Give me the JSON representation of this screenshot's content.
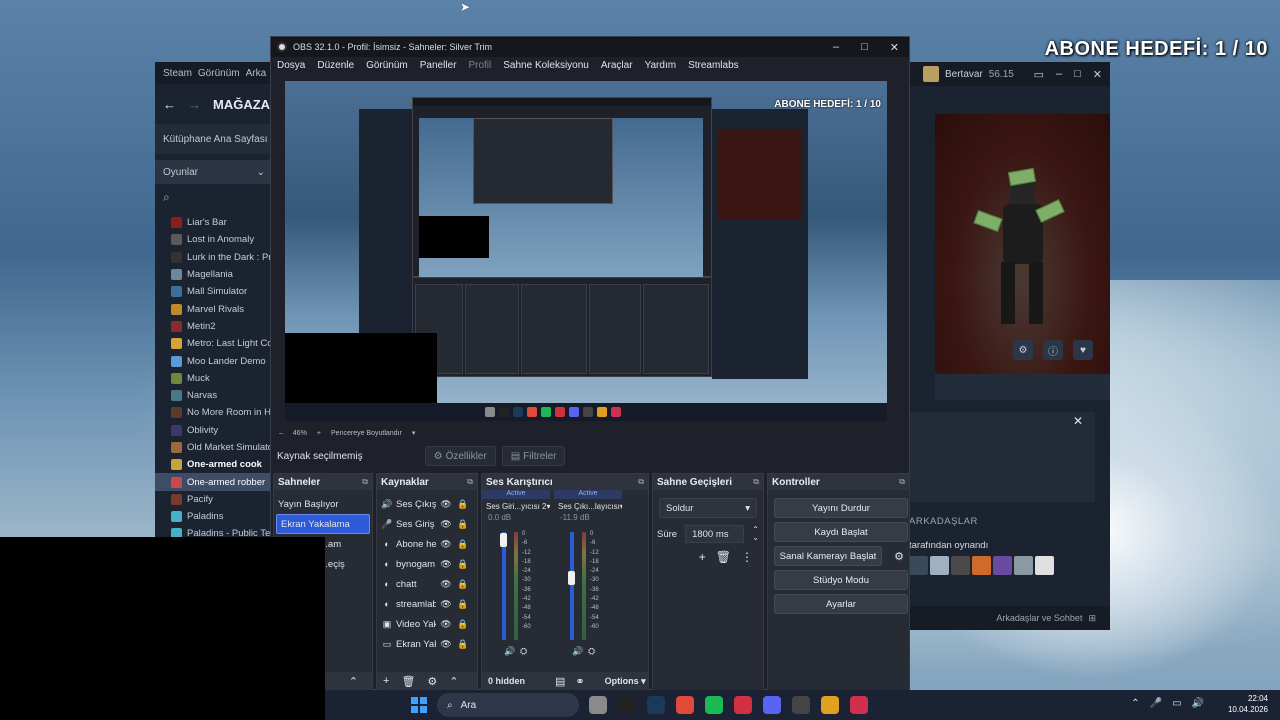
{
  "overlay": {
    "goal": "ABONE HEDEFİ: 1 / 10"
  },
  "steam": {
    "menu": [
      "Steam",
      "Görünüm",
      "Arka"
    ],
    "store": "MAĞAZA",
    "library_home": "Kütüphane Ana Sayfası",
    "filter": "Oyunlar",
    "games": [
      {
        "name": "Liar's Bar",
        "color": "#8a1d1d"
      },
      {
        "name": "Lost in Anomaly",
        "color": "#5a5a5a"
      },
      {
        "name": "Lurk in the Dark : Pr",
        "color": "#333333"
      },
      {
        "name": "Magellania",
        "color": "#6a8a9c"
      },
      {
        "name": "Mall Simulator",
        "color": "#3d6f9e"
      },
      {
        "name": "Marvel Rivals",
        "color": "#c08a2a"
      },
      {
        "name": "Metin2",
        "color": "#8a2a2a"
      },
      {
        "name": "Metro: Last Light Co",
        "color": "#d6a23a"
      },
      {
        "name": "Moo Lander Demo",
        "color": "#5a9ad6"
      },
      {
        "name": "Muck",
        "color": "#6c8a3a"
      },
      {
        "name": "Narvas",
        "color": "#4a7a8a"
      },
      {
        "name": "No More Room in He",
        "color": "#5a3a2a"
      },
      {
        "name": "Oblivity",
        "color": "#3a3a6a"
      },
      {
        "name": "Old Market Simulato",
        "color": "#9a6a3a"
      },
      {
        "name": "One-armed cook",
        "color": "#c9a23a"
      },
      {
        "name": "One-armed robber",
        "color": "#c94a4a"
      },
      {
        "name": "Pacify",
        "color": "#7a3a2a"
      },
      {
        "name": "Paladins",
        "color": "#4ab0c9"
      },
      {
        "name": "Paladins - Public Te",
        "color": "#4ab0c9"
      }
    ]
  },
  "steam_right": {
    "user": "Bertavar",
    "balance": "56.15",
    "friends_header": "ARKADAŞLAR",
    "played": "tarafından oynandı",
    "footer": "Arkadaşlar ve Sohbet",
    "avatar_colors": [
      "#3a4a5a",
      "#a0b0c0",
      "#4a4a4a",
      "#d06a2a",
      "#6a4aa0",
      "#8a9aa0",
      "#e0e0e0"
    ]
  },
  "obs": {
    "title": "OBS 32.1.0 - Profil: İsimsiz - Sahneler: Silver Trim",
    "menu": [
      "Dosya",
      "Düzenle",
      "Görünüm",
      "Paneller",
      "Profil",
      "Sahne Koleksiyonu",
      "Araçlar",
      "Yardım",
      "Streamlabs"
    ],
    "zoom": "46%",
    "fit": "Pencereye Boyutlandır",
    "no_source": "Kaynak seçilmemiş",
    "properties": "Özellikler",
    "filters": "Filtreler",
    "scenes": {
      "title": "Sahneler",
      "items": [
        "Yayın Başlıyor",
        "Ekran Yakalama",
        "...am",
        "...eçiş"
      ]
    },
    "sources": {
      "title": "Kaynaklar",
      "items": [
        {
          "icon": "🔊",
          "name": "Ses Çıkış Y"
        },
        {
          "icon": "🎤",
          "name": "Ses Giriş Y"
        },
        {
          "icon": "◐",
          "name": "Abone hed"
        },
        {
          "icon": "◐",
          "name": "bynogamı"
        },
        {
          "icon": "◐",
          "name": "chatt"
        },
        {
          "icon": "◐",
          "name": "streamlab"
        },
        {
          "icon": "▣",
          "name": "Video Yak"
        },
        {
          "icon": "▭",
          "name": "Ekran Yak"
        }
      ]
    },
    "mixer": {
      "title": "Ses Karıştırıcı",
      "channels": [
        {
          "active": "Active",
          "name": "Ses Giri...yıcısı 2",
          "db": "0.0 dB",
          "level": 0.95
        },
        {
          "active": "Active",
          "name": "Ses Çıkı...layıcısı",
          "db": "-11.9 dB",
          "level": 0.6
        }
      ],
      "scale": [
        "0",
        "-6",
        "-12",
        "-18",
        "-24",
        "-30",
        "-36",
        "-42",
        "-48",
        "-54",
        "-60"
      ],
      "hidden": "0 hidden",
      "options": "Options"
    },
    "transitions": {
      "title": "Sahne Geçişleri",
      "type": "Soldur",
      "duration_label": "Süre",
      "duration": "1800 ms"
    },
    "controls": {
      "title": "Kontroller",
      "stop_stream": "Yayını Durdur",
      "start_record": "Kaydı Başlat",
      "virtual_cam": "Sanal Kamerayı Başlat",
      "studio": "Stüdyo Modu",
      "settings": "Ayarlar"
    }
  },
  "taskbar": {
    "search": "Ara",
    "time": "22:04",
    "date": "10.04.2026",
    "app_colors": [
      "#8a8a8a",
      "#222222",
      "#1a3a5a",
      "#e04a3a",
      "#1db954",
      "#d03040",
      "#5865f2",
      "#444444",
      "#e0a020",
      "#d03050"
    ]
  }
}
